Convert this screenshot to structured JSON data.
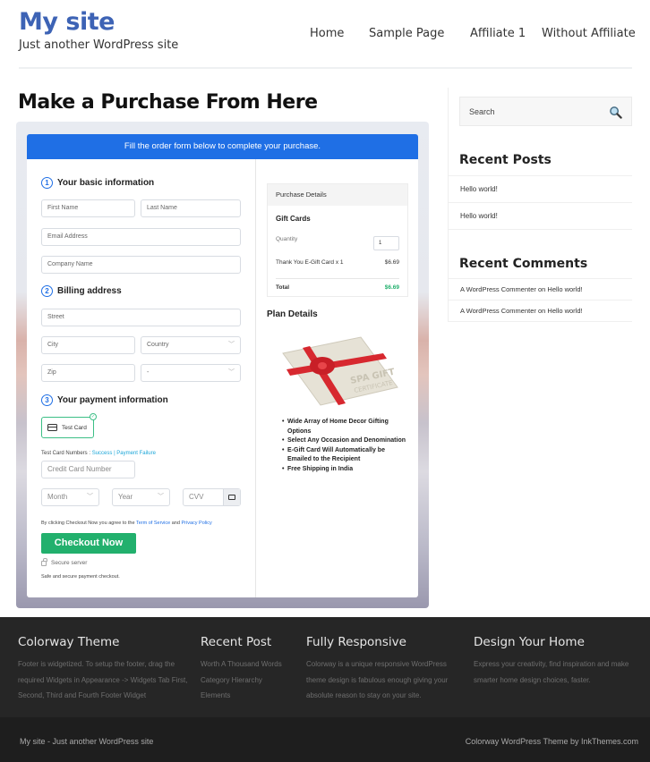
{
  "site": {
    "title": "My site",
    "tagline": "Just another WordPress site"
  },
  "nav": [
    {
      "label": "Home"
    },
    {
      "label": "Sample Page"
    },
    {
      "label": "Affiliate 1"
    },
    {
      "label": "Without Affiliate"
    }
  ],
  "page": {
    "title": "Make a Purchase From Here"
  },
  "checkout": {
    "banner": "Fill the order form below to complete your purchase.",
    "steps": [
      {
        "num": "1",
        "label": "Your basic information"
      },
      {
        "num": "2",
        "label": "Billing address"
      },
      {
        "num": "3",
        "label": "Your payment information"
      }
    ],
    "fields": {
      "first_name": "First Name",
      "last_name": "Last Name",
      "email": "Email Address",
      "company": "Company Name",
      "street": "Street",
      "city": "City",
      "country": "Country",
      "zip": "Zip",
      "state": "-",
      "card_number": "Credit Card Number",
      "month": "Month",
      "year": "Year",
      "cvv": "CVV"
    },
    "payment_method": "Test Card",
    "test_cards_label": "Test Card Numbers :",
    "test_success": "Success",
    "test_separator": "|",
    "test_failure": "Payment Failure",
    "agree_prefix": "By clicking Checkout Now you agree to the",
    "terms": "Term of Service",
    "agree_and": "and",
    "privacy": "Privacy Policy",
    "checkout_button": "Checkout Now",
    "secure_server": "Secure server",
    "secure_note": "Safe and secure payment checkout."
  },
  "purchase_details": {
    "heading": "Purchase Details",
    "product_group": "Gift Cards",
    "quantity_label": "Quantity",
    "quantity_value": "1",
    "item_label": "Thank You E-Gift Card x 1",
    "item_price": "$6.69",
    "total_label": "Total",
    "total_value": "$6.69",
    "total_color": "#22b06d"
  },
  "plan": {
    "heading": "Plan Details",
    "image_text_1": "SPA GIFT",
    "image_text_2": "CERTIFICATE",
    "features": [
      "Wide Array of Home Decor Gifting Options",
      "Select Any Occasion and Denomination",
      "E-Gift Card Will Automatically be Emailed to the Recipient",
      "Free Shipping in India"
    ]
  },
  "sidebar": {
    "search_placeholder": "Search",
    "recent_posts_heading": "Recent Posts",
    "recent_posts": [
      "Hello world!",
      "Hello world!"
    ],
    "recent_comments_heading": "Recent Comments",
    "recent_comments": [
      {
        "author": "A WordPress Commenter",
        "on": "on",
        "post": "Hello world!"
      },
      {
        "author": "A WordPress Commenter",
        "on": "on",
        "post": "Hello world!"
      }
    ]
  },
  "footer": {
    "columns": [
      {
        "heading": "Colorway Theme",
        "text": "Footer is widgetized. To setup the footer, drag the required Widgets in Appearance -> Widgets Tab First, Second, Third and Fourth Footer Widget"
      },
      {
        "heading": "Recent Post",
        "links": [
          "Worth A Thousand Words",
          "Category Hierarchy",
          "Elements"
        ]
      },
      {
        "heading": "Fully Responsive",
        "text": "Colorway is a unique responsive WordPress theme design is fabulous enough giving your absolute reason to stay on your site."
      },
      {
        "heading": "Design Your Home",
        "text": "Express your creativity, find inspiration and make smarter home design choices, faster."
      }
    ],
    "bottom_left": "My site - Just another WordPress site",
    "bottom_right": "Colorway WordPress Theme by InkThemes.com"
  },
  "colors": {
    "brand": "#3d63b5",
    "banner": "#1f6fe5",
    "checkout": "#22b06d",
    "footer": "#262626"
  }
}
